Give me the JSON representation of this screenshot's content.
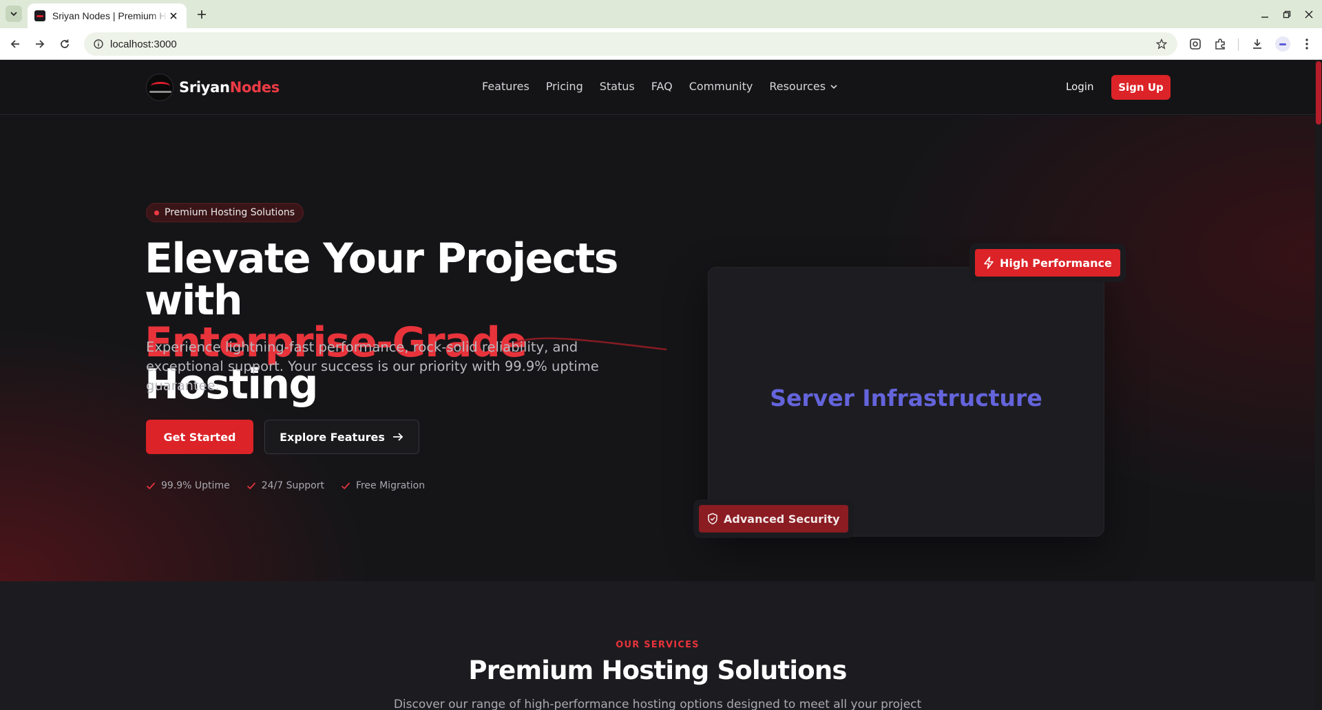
{
  "browser": {
    "tab_title": "Sriyan Nodes | Premium Hosting",
    "url": "localhost:3000"
  },
  "nav": {
    "brand_a": "Sriyan",
    "brand_b": "Nodes",
    "links": [
      "Features",
      "Pricing",
      "Status",
      "FAQ",
      "Community",
      "Resources"
    ],
    "login": "Login",
    "signup": "Sign Up"
  },
  "hero": {
    "badge": "Premium Hosting Solutions",
    "headline_line1": "Elevate Your Projects with",
    "headline_red": "Enterprise-Grade",
    "headline_rest": " Hosting",
    "subtext": "Experience lightning-fast performance, rock-solid reliability, and exceptional support. Your success is our priority with 99.9% uptime guarantee.",
    "primary_button": "Get Started",
    "secondary_button": "Explore Features",
    "checks": [
      "99.9% Uptime",
      "24/7 Support",
      "Free Migration"
    ],
    "card_title": "Server Infrastructure",
    "badge_performance": "High Performance",
    "badge_security": "Advanced Security"
  },
  "services": {
    "eyebrow": "OUR SERVICES",
    "title": "Premium Hosting Solutions",
    "description": "Discover our range of high-performance hosting options designed to meet all your project"
  },
  "colors": {
    "accent": "#dc2328",
    "background": "#141416",
    "infra_title": "#6464dc"
  },
  "icons": {
    "tab_search": "chevron-down-icon",
    "back": "arrow-left-icon",
    "forward": "arrow-right-icon",
    "reload": "reload-icon",
    "site_info": "info-icon",
    "bookmark": "star-icon",
    "performance": "lightning-icon",
    "security": "shield-check-icon",
    "check": "check-icon"
  }
}
